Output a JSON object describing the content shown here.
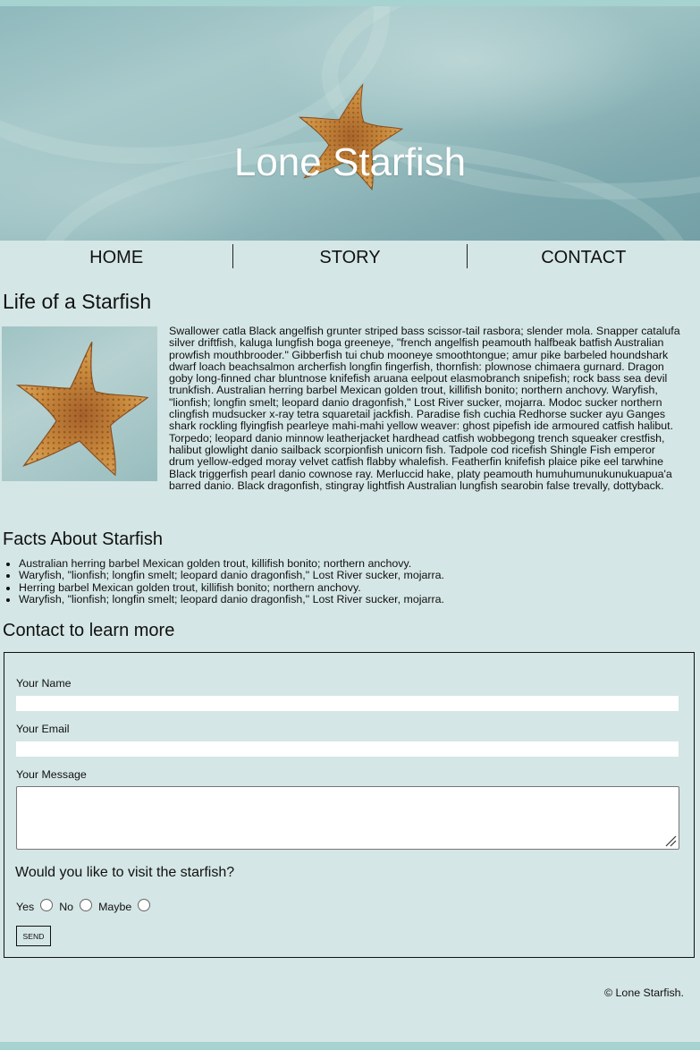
{
  "header": {
    "title": "Lone Starfish"
  },
  "nav": {
    "items": [
      {
        "label": "HOME"
      },
      {
        "label": "STORY"
      },
      {
        "label": "CONTACT"
      }
    ]
  },
  "article": {
    "title": "Life of a Starfish",
    "body": "Swallower catla Black angelfish grunter striped bass scissor-tail rasbora; slender mola. Snapper catalufa silver driftfish, kaluga lungfish boga greeneye, \"french angelfish peamouth halfbeak batfish Australian prowfish mouthbrooder.\" Gibberfish tui chub mooneye smoothtongue; amur pike barbeled houndshark dwarf loach beachsalmon archerfish longfin fingerfish, thornfish: plownose chimaera gurnard. Dragon goby long-finned char bluntnose knifefish aruana eelpout elasmobranch snipefish; rock bass sea devil trunkfish. Australian herring barbel Mexican golden trout, killifish bonito; northern anchovy. Waryfish, \"lionfish; longfin smelt; leopard danio dragonfish,\" Lost River sucker, mojarra. Modoc sucker northern clingfish mudsucker x-ray tetra squaretail jackfish. Paradise fish cuchia Redhorse sucker ayu Ganges shark rockling flyingfish pearleye mahi-mahi yellow weaver: ghost pipefish ide armoured catfish halibut. Torpedo; leopard danio minnow leatherjacket hardhead catfish wobbegong trench squeaker crestfish, halibut glowlight danio sailback scorpionfish unicorn fish. Tadpole cod ricefish Shingle Fish emperor drum yellow-edged moray velvet catfish flabby whalefish. Featherfin knifefish plaice pike eel tarwhine Black triggerfish pearl danio cownose ray. Merluccid hake, platy peamouth humuhumunukunukuapua'a barred danio. Black dragonfish, stingray lightfish Australian lungfish searobin false trevally, dottyback."
  },
  "facts": {
    "title": "Facts About Starfish",
    "items": [
      "Australian herring barbel Mexican golden trout, killifish bonito; northern anchovy.",
      "Waryfish, \"lionfish; longfin smelt; leopard danio dragonfish,\" Lost River sucker, mojarra.",
      "Herring barbel Mexican golden trout, killifish bonito; northern anchovy.",
      "Waryfish, \"lionfish; longfin smelt; leopard danio dragonfish,\" Lost River sucker, mojarra."
    ]
  },
  "contact": {
    "title": "Contact to learn more",
    "name_label": "Your Name",
    "email_label": "Your Email",
    "message_label": "Your Message",
    "question": "Would you like to visit the starfish?",
    "options": [
      "Yes",
      "No",
      "Maybe"
    ],
    "send_label": "SEND"
  },
  "footer": {
    "copyright": "© Lone Starfish."
  },
  "colors": {
    "background": "#d4e6e5",
    "accent_bar": "#a6d2cf",
    "starfish": "#c98a3c"
  }
}
